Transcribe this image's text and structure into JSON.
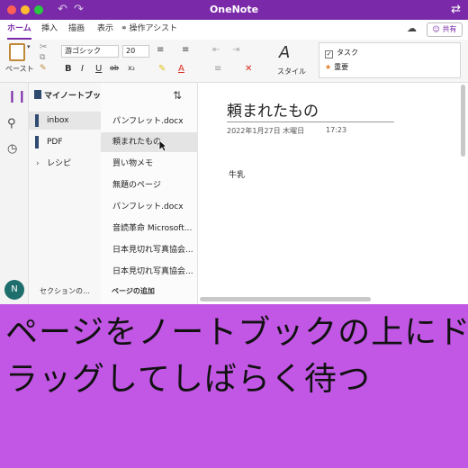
{
  "window": {
    "title": "OneNote",
    "undo_icon": "↶",
    "redo_icon": "↷",
    "sync_icon": "⇄"
  },
  "tabs": {
    "items": [
      "ホーム",
      "挿入",
      "描画",
      "表示"
    ],
    "assist": "操作アシスト",
    "share": "共有",
    "active_index": 0
  },
  "ribbon": {
    "paste_label": "ペースト",
    "font": "游ゴシック",
    "size": "20",
    "style_label": "スタイル",
    "tag_task": "タスク",
    "tag_important": "重要",
    "bold": "B",
    "italic": "I",
    "underline": "U",
    "strike": "ab",
    "subscript": "x₂"
  },
  "notebook": {
    "name": "マイノートブック",
    "sections": [
      {
        "label": "inbox",
        "color": "#2f4a6f",
        "selected": true
      },
      {
        "label": "PDF",
        "color": "#2f4a6f",
        "selected": false
      },
      {
        "label": "レシピ",
        "color": "",
        "selected": false,
        "group": true
      }
    ],
    "add_section": "セクションの…",
    "avatar_initial": "N"
  },
  "pages": {
    "items": [
      "パンフレット.docx",
      "頼まれたもの",
      "買い物メモ",
      "無題のページ",
      "パンフレット.docx",
      "音読革命 Microsoft...",
      "日本見切れ写真協会...",
      "日本見切れ写真協会..."
    ],
    "selected_index": 1,
    "add_page": "ページの追加"
  },
  "note": {
    "title": "頼まれたもの",
    "date": "2022年1月27日 木曜日",
    "time": "17:23",
    "body": "牛乳"
  },
  "caption": {
    "line1": "ページをノートブックの上にド",
    "line2": "ラッグしてしばらく待つ"
  },
  "colors": {
    "brand": "#7a2aa8",
    "banner": "#c257e6",
    "section_accent": "#2f4a6f"
  }
}
